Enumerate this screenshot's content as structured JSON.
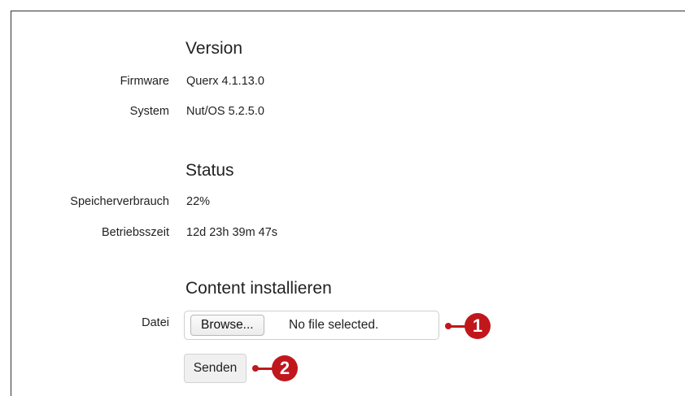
{
  "sections": {
    "version": {
      "title": "Version",
      "rows": [
        {
          "label": "Firmware",
          "value": "Querx 4.1.13.0"
        },
        {
          "label": "System",
          "value": "Nut/OS 5.2.5.0"
        }
      ]
    },
    "status": {
      "title": "Status",
      "rows": [
        {
          "label": "Speicherverbrauch",
          "value": "22%"
        },
        {
          "label": "Betriebsszeit",
          "value": "12d 23h 39m 47s"
        }
      ]
    },
    "content": {
      "title": "Content installieren",
      "file_label": "Datei",
      "browse_label": "Browse...",
      "file_status": "No file selected.",
      "submit_label": "Senden"
    }
  },
  "callouts": [
    "1",
    "2"
  ],
  "colors": {
    "callout": "#c0171c"
  }
}
